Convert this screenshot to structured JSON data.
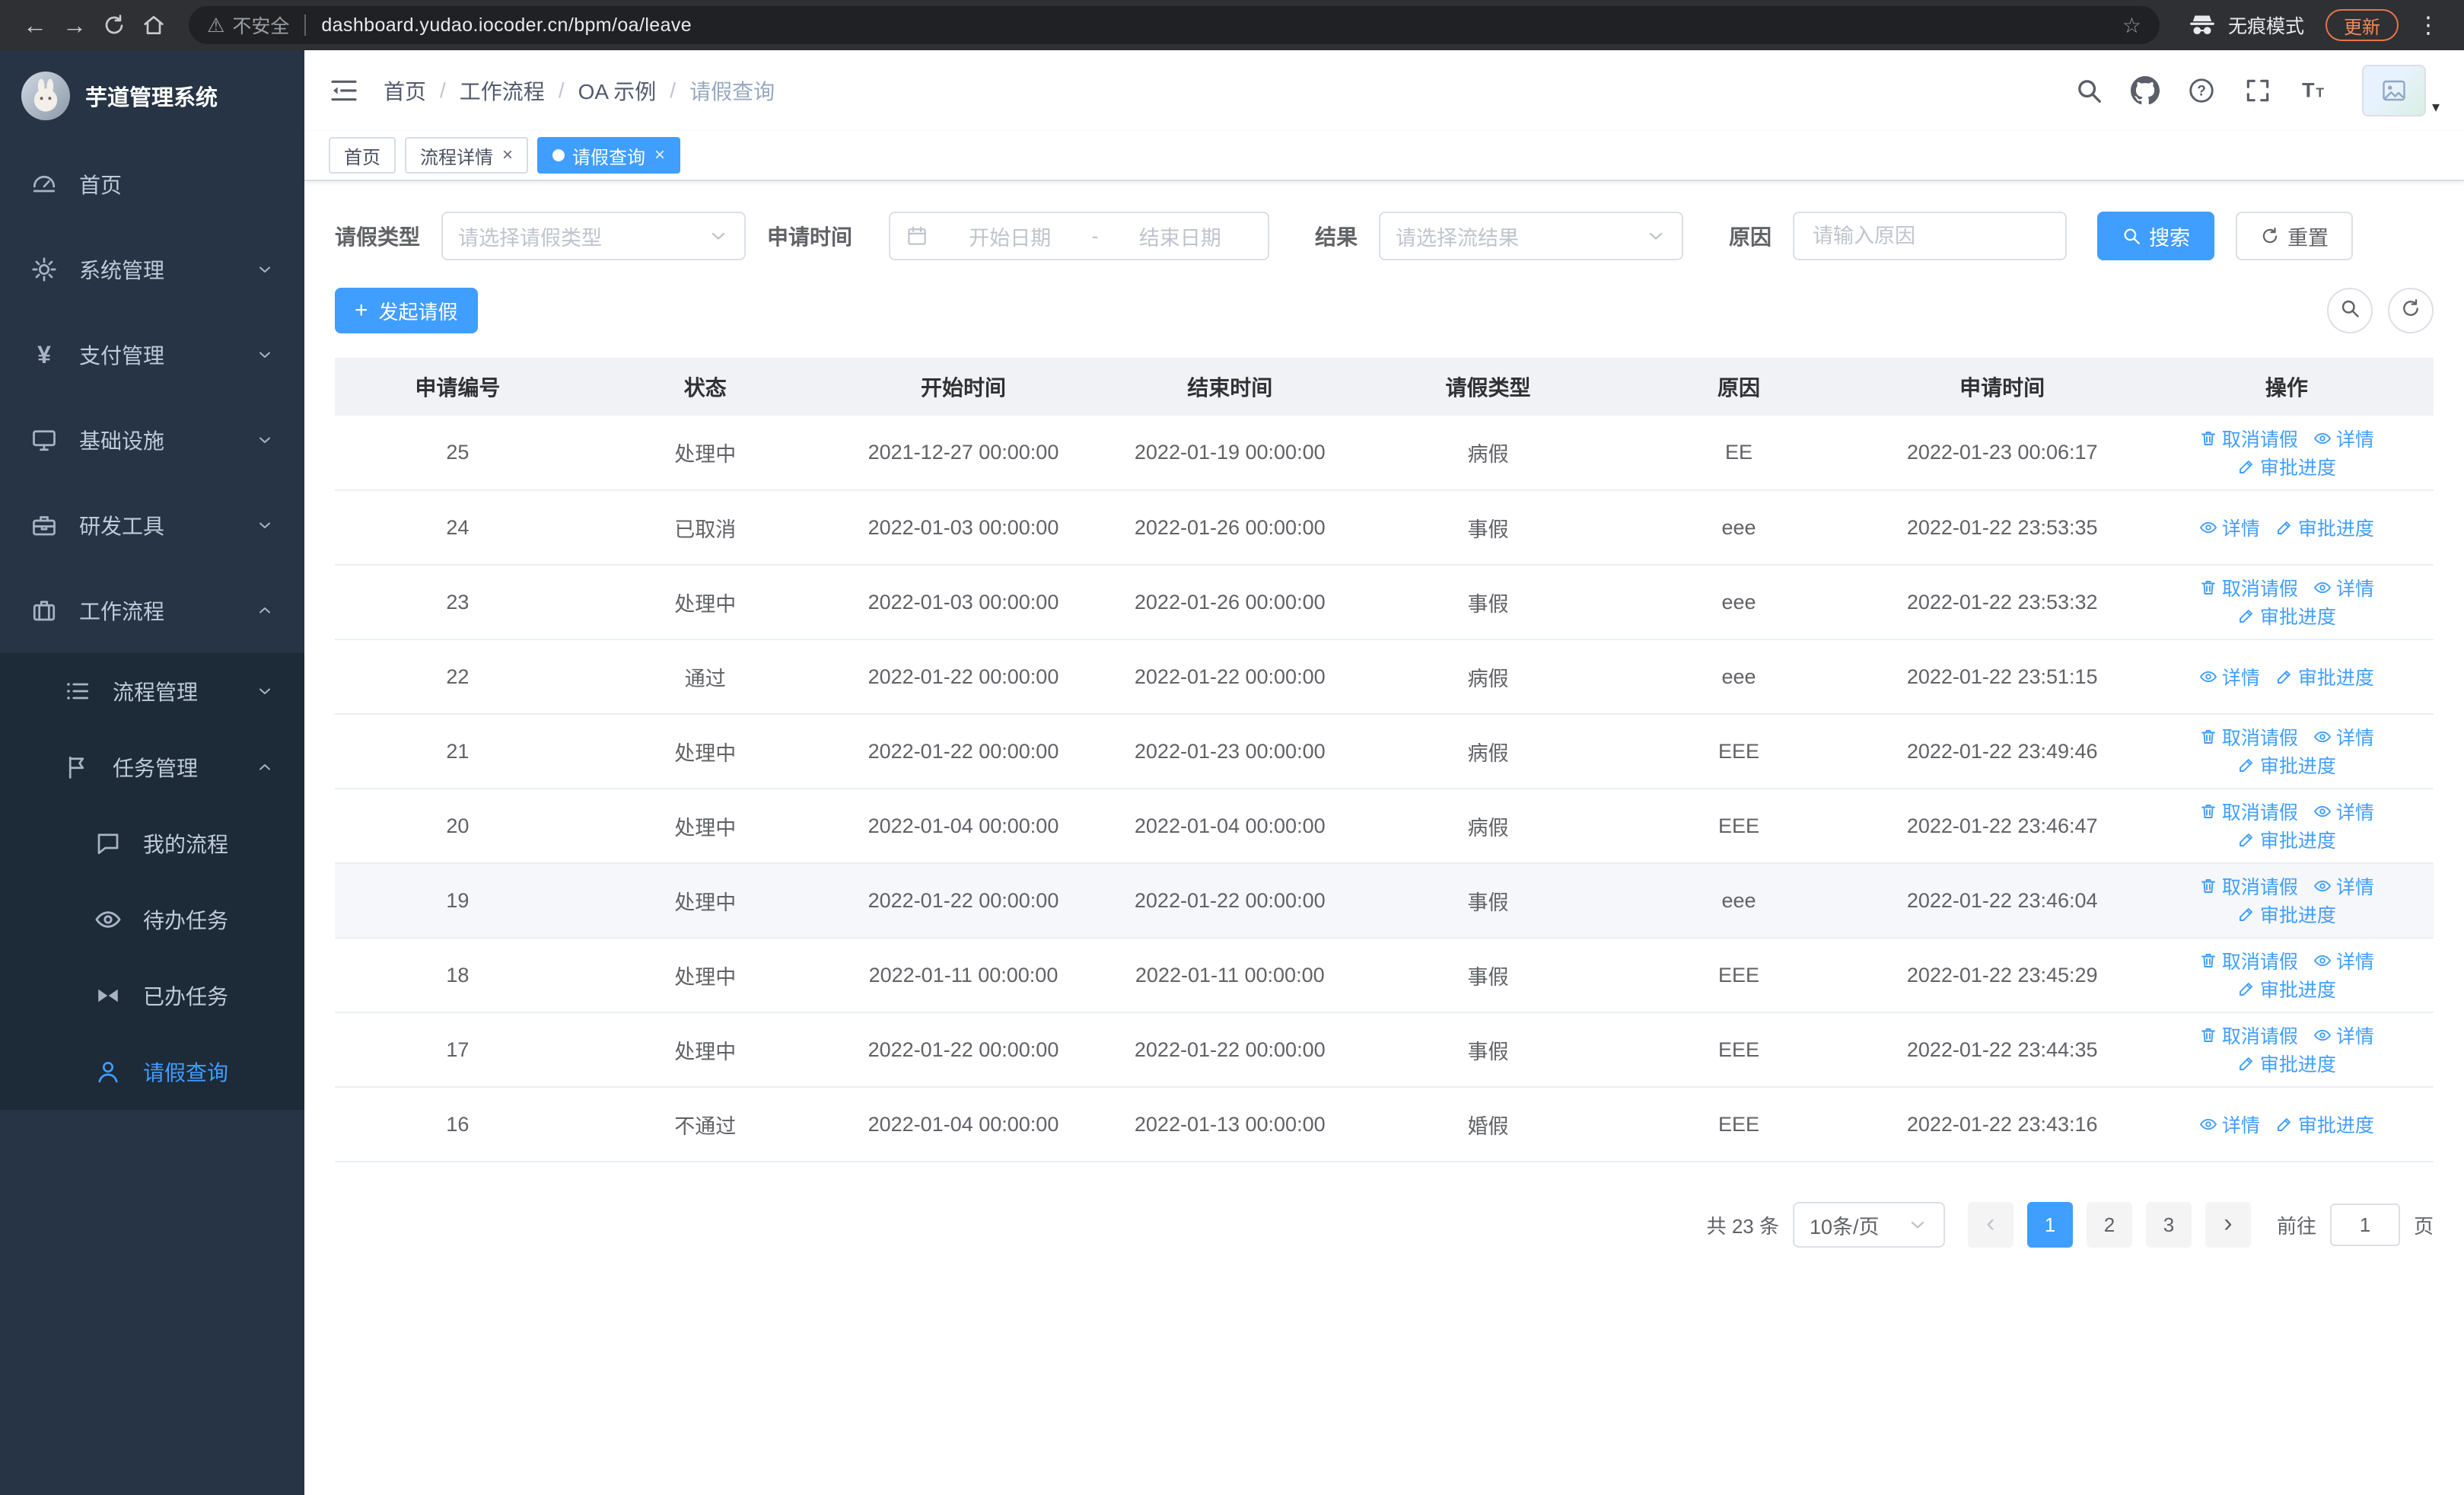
{
  "icons": {
    "back": "←",
    "forward": "→",
    "star": "☆",
    "warning": "⚠",
    "kebab": "⋮",
    "close": "×",
    "prev": "‹",
    "next": "›",
    "plus": "+",
    "caret": "▾"
  },
  "browser": {
    "security_label": "不安全",
    "url": "dashboard.yudao.iocoder.cn/bpm/oa/leave",
    "incognito_label": "无痕模式",
    "update_label": "更新"
  },
  "sidebar": {
    "title": "芋道管理系统",
    "menu": [
      {
        "key": "home",
        "label": "首页",
        "icon": "dashboard-icon",
        "type": "item",
        "state": "none"
      },
      {
        "key": "system",
        "label": "系统管理",
        "icon": "gear-icon",
        "type": "submenu",
        "state": "collapsed"
      },
      {
        "key": "payment",
        "label": "支付管理",
        "icon": "yen-icon",
        "type": "submenu",
        "state": "collapsed"
      },
      {
        "key": "infra",
        "label": "基础设施",
        "icon": "monitor-icon",
        "type": "submenu",
        "state": "collapsed"
      },
      {
        "key": "devtools",
        "label": "研发工具",
        "icon": "toolbox-icon",
        "type": "submenu",
        "state": "collapsed"
      },
      {
        "key": "workflow",
        "label": "工作流程",
        "icon": "briefcase-icon",
        "type": "submenu",
        "state": "expanded"
      }
    ],
    "workflow_submenu": [
      {
        "key": "process-mgmt",
        "label": "流程管理",
        "icon": "list-icon",
        "state": "collapsed"
      },
      {
        "key": "task-mgmt",
        "label": "任务管理",
        "icon": "flag-icon",
        "state": "expanded"
      }
    ],
    "task_submenu": [
      {
        "key": "my-process",
        "label": "我的流程",
        "icon": "chat-icon",
        "active": false
      },
      {
        "key": "todo-tasks",
        "label": "待办任务",
        "icon": "eye-icon",
        "active": false
      },
      {
        "key": "done-tasks",
        "label": "已办任务",
        "icon": "bowtie-icon",
        "active": false
      },
      {
        "key": "leave-query",
        "label": "请假查询",
        "icon": "user-icon",
        "active": true
      }
    ]
  },
  "header": {
    "breadcrumb": [
      "首页",
      "工作流程",
      "OA 示例",
      "请假查询"
    ]
  },
  "tabs": [
    {
      "key": "home",
      "label": "首页",
      "closable": false,
      "active": false
    },
    {
      "key": "process-detail",
      "label": "流程详情",
      "closable": true,
      "active": false
    },
    {
      "key": "leave-query",
      "label": "请假查询",
      "closable": true,
      "active": true
    }
  ],
  "filters": {
    "leave_type_label": "请假类型",
    "leave_type_placeholder": "请选择请假类型",
    "apply_time_label": "申请时间",
    "start_date_placeholder": "开始日期",
    "range_separator": "-",
    "end_date_placeholder": "结束日期",
    "result_label": "结果",
    "result_placeholder": "请选择流结果",
    "reason_label": "原因",
    "reason_placeholder": "请输入原因",
    "search_button": "搜索",
    "reset_button": "重置"
  },
  "toolbar": {
    "create_button": "发起请假"
  },
  "table": {
    "columns": [
      {
        "key": "id",
        "label": "申请编号"
      },
      {
        "key": "status",
        "label": "状态"
      },
      {
        "key": "start_time",
        "label": "开始时间"
      },
      {
        "key": "end_time",
        "label": "结束时间"
      },
      {
        "key": "leave_type",
        "label": "请假类型"
      },
      {
        "key": "reason",
        "label": "原因"
      },
      {
        "key": "apply_time",
        "label": "申请时间"
      },
      {
        "key": "actions",
        "label": "操作"
      }
    ],
    "action_labels": {
      "cancel": "取消请假",
      "detail": "详情",
      "progress": "审批进度"
    },
    "rows": [
      {
        "id": "25",
        "status": "处理中",
        "start_time": "2021-12-27 00:00:00",
        "end_time": "2022-01-19 00:00:00",
        "leave_type": "病假",
        "reason": "EE",
        "apply_time": "2022-01-23 00:06:17",
        "actions": [
          "cancel",
          "detail",
          "progress"
        ],
        "highlighted": false
      },
      {
        "id": "24",
        "status": "已取消",
        "start_time": "2022-01-03 00:00:00",
        "end_time": "2022-01-26 00:00:00",
        "leave_type": "事假",
        "reason": "eee",
        "apply_time": "2022-01-22 23:53:35",
        "actions": [
          "detail",
          "progress"
        ],
        "highlighted": false
      },
      {
        "id": "23",
        "status": "处理中",
        "start_time": "2022-01-03 00:00:00",
        "end_time": "2022-01-26 00:00:00",
        "leave_type": "事假",
        "reason": "eee",
        "apply_time": "2022-01-22 23:53:32",
        "actions": [
          "cancel",
          "detail",
          "progress"
        ],
        "highlighted": false
      },
      {
        "id": "22",
        "status": "通过",
        "start_time": "2022-01-22 00:00:00",
        "end_time": "2022-01-22 00:00:00",
        "leave_type": "病假",
        "reason": "eee",
        "apply_time": "2022-01-22 23:51:15",
        "actions": [
          "detail",
          "progress"
        ],
        "highlighted": false
      },
      {
        "id": "21",
        "status": "处理中",
        "start_time": "2022-01-22 00:00:00",
        "end_time": "2022-01-23 00:00:00",
        "leave_type": "病假",
        "reason": "EEE",
        "apply_time": "2022-01-22 23:49:46",
        "actions": [
          "cancel",
          "detail",
          "progress"
        ],
        "highlighted": false
      },
      {
        "id": "20",
        "status": "处理中",
        "start_time": "2022-01-04 00:00:00",
        "end_time": "2022-01-04 00:00:00",
        "leave_type": "病假",
        "reason": "EEE",
        "apply_time": "2022-01-22 23:46:47",
        "actions": [
          "cancel",
          "detail",
          "progress"
        ],
        "highlighted": false
      },
      {
        "id": "19",
        "status": "处理中",
        "start_time": "2022-01-22 00:00:00",
        "end_time": "2022-01-22 00:00:00",
        "leave_type": "事假",
        "reason": "eee",
        "apply_time": "2022-01-22 23:46:04",
        "actions": [
          "cancel",
          "detail",
          "progress"
        ],
        "highlighted": true
      },
      {
        "id": "18",
        "status": "处理中",
        "start_time": "2022-01-11 00:00:00",
        "end_time": "2022-01-11 00:00:00",
        "leave_type": "事假",
        "reason": "EEE",
        "apply_time": "2022-01-22 23:45:29",
        "actions": [
          "cancel",
          "detail",
          "progress"
        ],
        "highlighted": false
      },
      {
        "id": "17",
        "status": "处理中",
        "start_time": "2022-01-22 00:00:00",
        "end_time": "2022-01-22 00:00:00",
        "leave_type": "事假",
        "reason": "EEE",
        "apply_time": "2022-01-22 23:44:35",
        "actions": [
          "cancel",
          "detail",
          "progress"
        ],
        "highlighted": false
      },
      {
        "id": "16",
        "status": "不通过",
        "start_time": "2022-01-04 00:00:00",
        "end_time": "2022-01-13 00:00:00",
        "leave_type": "婚假",
        "reason": "EEE",
        "apply_time": "2022-01-22 23:43:16",
        "actions": [
          "detail",
          "progress"
        ],
        "highlighted": false
      }
    ]
  },
  "pagination": {
    "total": "共 23 条",
    "page_size": "10条/页",
    "pages": [
      "1",
      "2",
      "3"
    ],
    "active_page": "1",
    "goto_label": "前往",
    "goto_value": "1",
    "goto_unit": "页"
  },
  "colors": {
    "primary": "#409eff",
    "sidebar_bg": "#263445",
    "sidebar_sub_bg": "#1d2a38",
    "update_accent": "#e8744a"
  }
}
